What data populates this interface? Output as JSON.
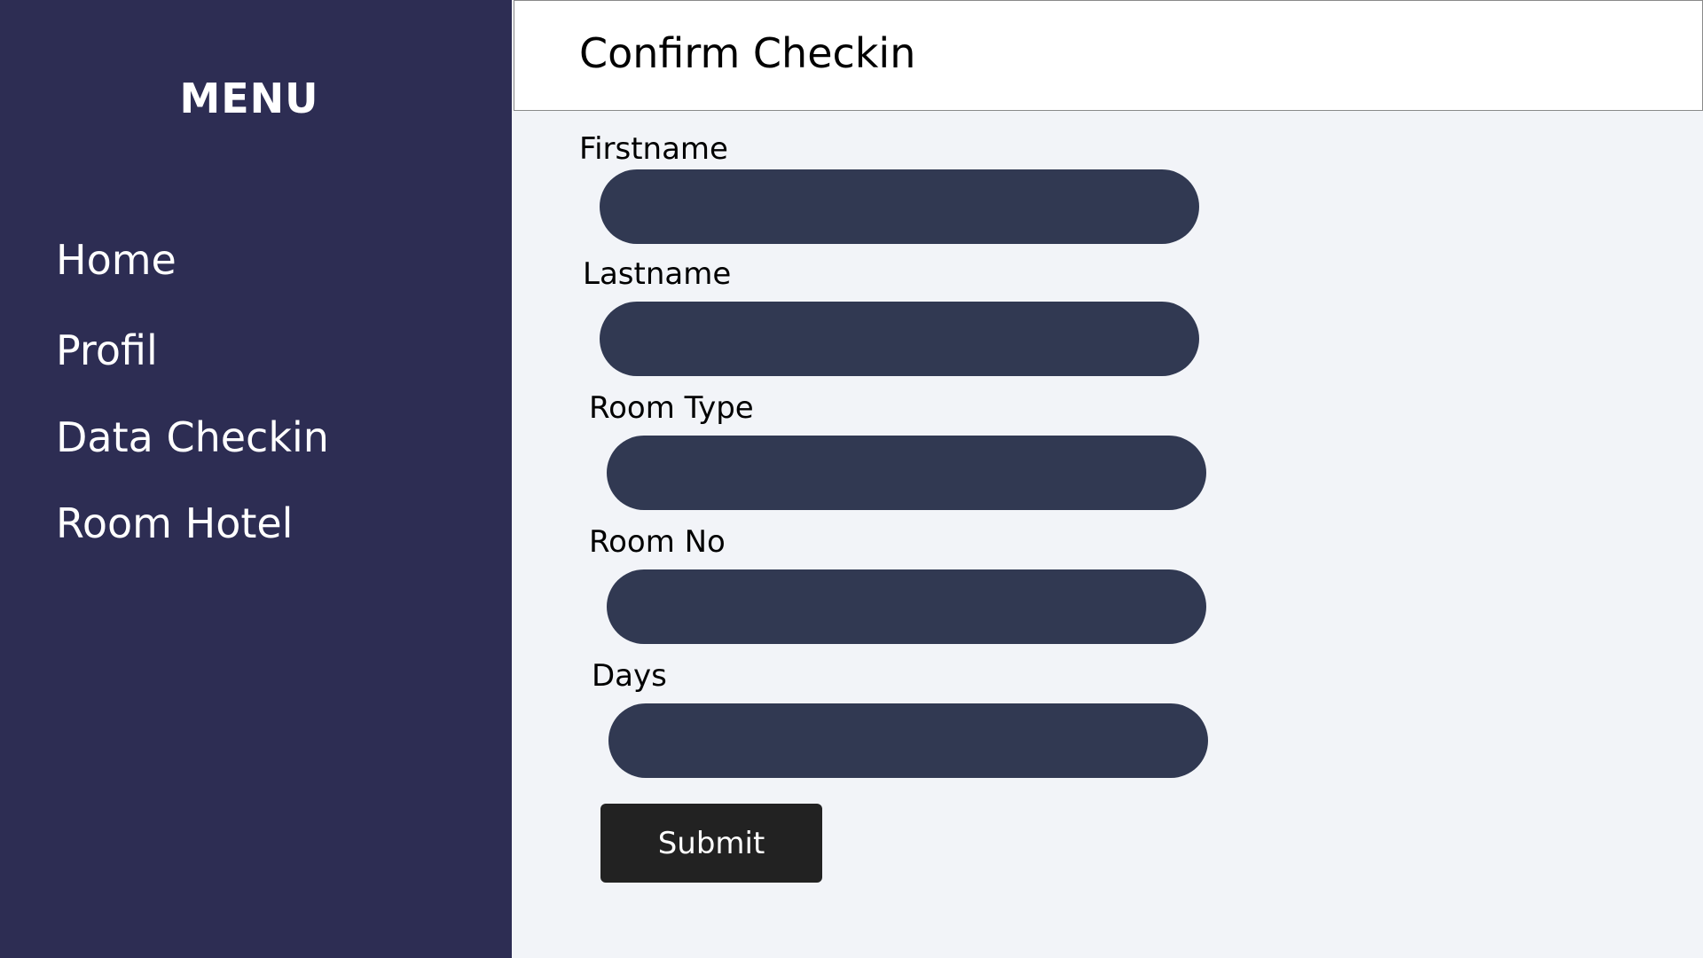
{
  "sidebar": {
    "title": "MENU",
    "items": [
      {
        "label": "Home"
      },
      {
        "label": "Profil"
      },
      {
        "label": "Data Checkin"
      },
      {
        "label": "Room Hotel"
      }
    ]
  },
  "header": {
    "title": "Confirm Checkin"
  },
  "form": {
    "fields": [
      {
        "label": "Firstname",
        "value": ""
      },
      {
        "label": "Lastname",
        "value": ""
      },
      {
        "label": "Room Type",
        "value": ""
      },
      {
        "label": "Room No",
        "value": ""
      },
      {
        "label": "Days",
        "value": ""
      }
    ],
    "submit_label": "Submit"
  },
  "colors": {
    "sidebar_bg": "#2d2d53",
    "content_bg": "#f2f4f8",
    "input_bg": "#313952",
    "button_bg": "#222222"
  }
}
